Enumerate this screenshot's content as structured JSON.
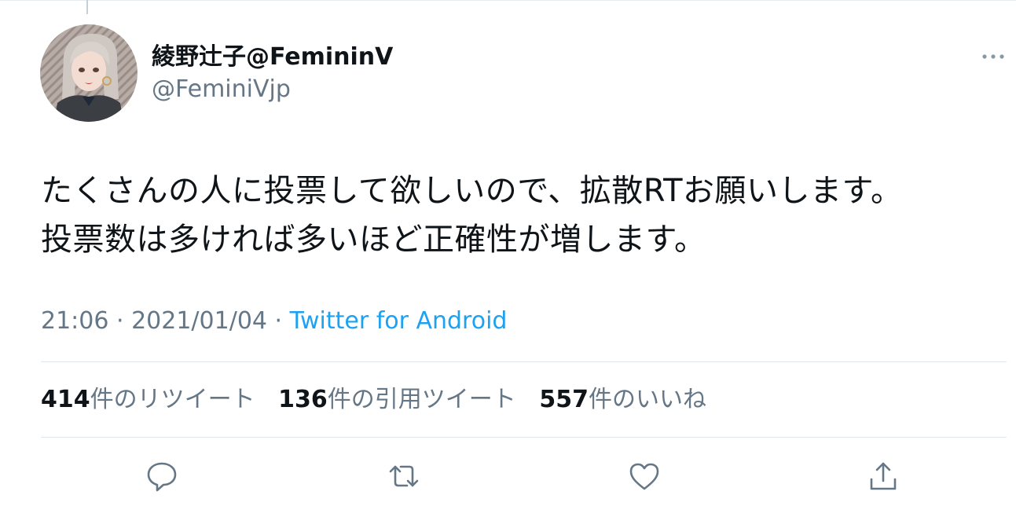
{
  "tweet": {
    "display_name": "綾野辻子@FemininV",
    "handle": "@FeminiVjp",
    "text_lines": [
      "たくさんの人に投票して欲しいので、拡散RTお願いします。",
      "投票数は多ければ多いほど正確性が増します。"
    ],
    "time": "21:06",
    "date": "2021/01/04",
    "separator": " · ",
    "source": "Twitter for Android"
  },
  "stats": {
    "retweets": {
      "count": "414",
      "label": "件のリツイート"
    },
    "quotes": {
      "count": "136",
      "label": "件の引用ツイート"
    },
    "likes": {
      "count": "557",
      "label": "件のいいね"
    }
  },
  "actions": {
    "icons": [
      "reply-icon",
      "retweet-icon",
      "like-icon",
      "share-icon"
    ]
  },
  "colors": {
    "text": "#0f1419",
    "secondary": "#657786",
    "link": "#1da1f2",
    "divider": "#e1e8ed"
  }
}
